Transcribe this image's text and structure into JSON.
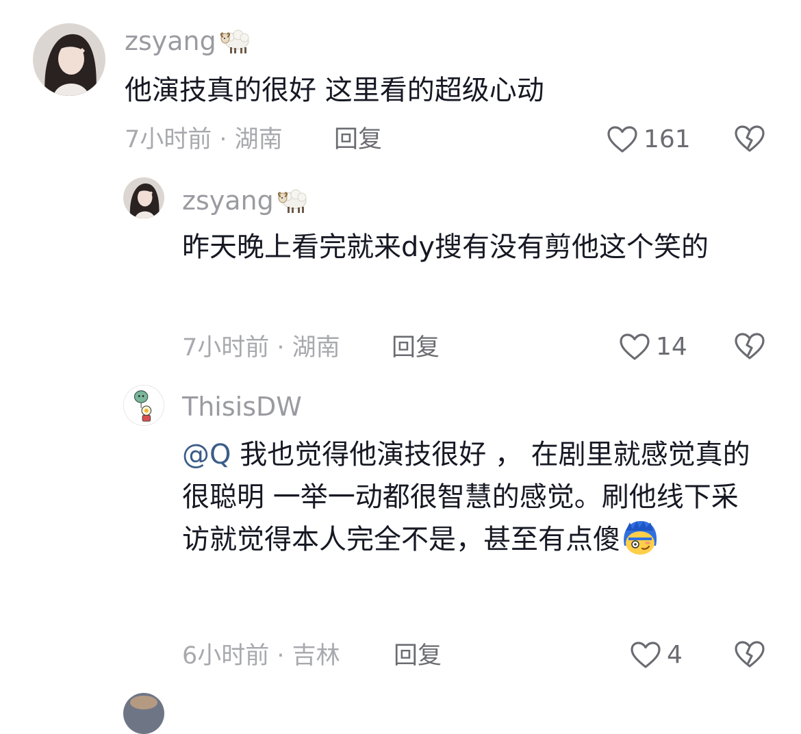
{
  "comments": [
    {
      "username": "zsyang",
      "text": "他演技真的很好 这里看的超级心动",
      "meta": "7小时前 · 湖南",
      "reply_label": "回复",
      "likes": "161"
    },
    {
      "username": "zsyang",
      "text": "昨天晚上看完就来dy搜有没有剪他这个笑的",
      "meta": "7小时前 · 湖南",
      "reply_label": "回复",
      "likes": "14"
    },
    {
      "username": "ThisisDW",
      "mention": "@Q",
      "text": " 我也觉得他演技很好 ， 在剧里就感觉真的很聪明 一举一动都很智慧的感觉。刷他线下采访就觉得本人完全不是，甚至有点傻",
      "meta": "6小时前 · 吉林",
      "reply_label": "回复",
      "likes": "4"
    }
  ],
  "icons": {
    "like": "heart-outline-icon",
    "dislike": "broken-heart-icon",
    "username_emoji": "sheep-emoji",
    "text_emoji": "embarrassed-face-emoji"
  },
  "colors": {
    "text": "#161823",
    "username": "#9a9ba1",
    "meta": "#a8a9ae",
    "mention": "#3c5d8a",
    "icon": "#6b6c72"
  }
}
